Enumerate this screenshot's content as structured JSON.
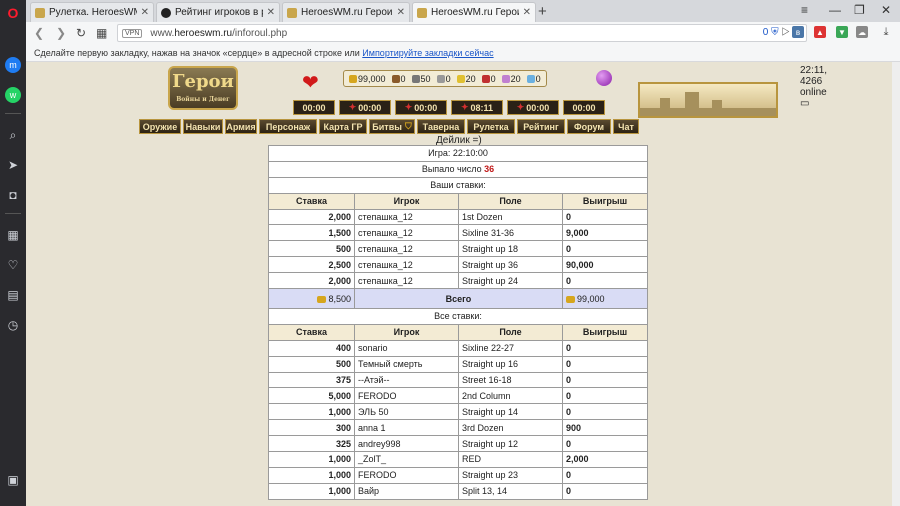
{
  "tabs": [
    {
      "title": "Рулетка. HeroesWM.ru Гер",
      "active": false
    },
    {
      "title": "Рейтинг игроков в рулет",
      "active": false
    },
    {
      "title": "HeroesWM.ru Герои войн",
      "active": false
    },
    {
      "title": "HeroesWM.ru Герои войн",
      "active": true
    }
  ],
  "address": {
    "vpn": "VPN",
    "prefix": "www.",
    "host": "heroeswm.ru",
    "path": "/inforoul.php",
    "badge": "0"
  },
  "bookmark_hint": {
    "text": "Сделайте первую закладку, нажав на значок «сердце» в адресной строке или",
    "link": "Импортируйте закладки сейчас"
  },
  "header": {
    "logo": "Герои",
    "logo_sub": "Войны и Денег",
    "online": "22:11, 4266 online",
    "resources": [
      "99,000",
      "0",
      "50",
      "0",
      "20",
      "0",
      "20",
      "0"
    ],
    "timers": [
      "00:00",
      "00:00",
      "00:00",
      "08:11",
      "00:00",
      "00:00"
    ]
  },
  "menu": [
    "Оружие",
    "Навыки",
    "Армия",
    "Персонаж",
    "Карта ГР",
    "Битвы",
    "Таверна",
    "Рулетка",
    "Рейтинг",
    "Форум",
    "Чат"
  ],
  "day_label": "Дейлик =)",
  "game": {
    "time_line": "Игра: 22:10:00",
    "result_prefix": "Выпало число",
    "result_number": "36",
    "your_bets_title": "Ваши ставки:",
    "all_bets_title": "Все ставки:",
    "columns": [
      "Ставка",
      "Игрок",
      "Поле",
      "Выигрыш"
    ],
    "your_bets": [
      [
        "2,000",
        "степашка_12",
        "1st Dozen",
        "0"
      ],
      [
        "1,500",
        "степашка_12",
        "Sixline 31-36",
        "9,000"
      ],
      [
        "500",
        "степашка_12",
        "Straight up 18",
        "0"
      ],
      [
        "2,500",
        "степашка_12",
        "Straight up 36",
        "90,000"
      ],
      [
        "2,000",
        "степашка_12",
        "Straight up 24",
        "0"
      ]
    ],
    "total": {
      "stake": "8,500",
      "label": "Всего",
      "win": "99,000"
    },
    "all_bets": [
      [
        "400",
        "sonario",
        "Sixline 22-27",
        "0"
      ],
      [
        "500",
        "Темный смерть",
        "Straight up 16",
        "0"
      ],
      [
        "375",
        "--Атэй--",
        "Street 16-18",
        "0"
      ],
      [
        "5,000",
        "FERODO",
        "2nd Column",
        "0"
      ],
      [
        "1,000",
        "ЭЛЬ 50",
        "Straight up 14",
        "0"
      ],
      [
        "300",
        "anna 1",
        "3rd Dozen",
        "900"
      ],
      [
        "325",
        "andrey998",
        "Straight up 12",
        "0"
      ],
      [
        "1,000",
        "_ZolT_",
        "RED",
        "2,000"
      ],
      [
        "1,000",
        "FERODO",
        "Straight up 23",
        "0"
      ],
      [
        "1,000",
        "Вайр",
        "Split 13, 14",
        "0"
      ]
    ]
  }
}
